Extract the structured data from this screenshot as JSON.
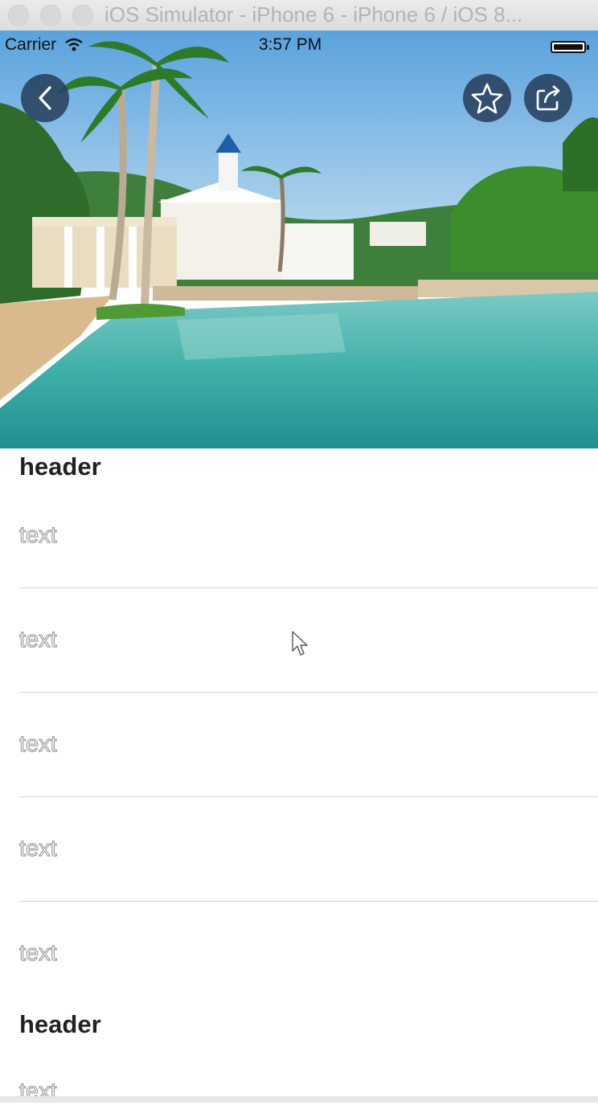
{
  "window": {
    "title": "iOS Simulator - iPhone 6 - iPhone 6 / iOS 8..."
  },
  "status_bar": {
    "carrier": "Carrier",
    "time": "3:57 PM",
    "wifi_icon": "wifi-icon",
    "battery_icon": "battery-icon"
  },
  "nav": {
    "back_icon": "chevron-left-icon",
    "favorite_icon": "star-icon",
    "share_icon": "share-icon"
  },
  "sections": [
    {
      "header": "header",
      "rows": [
        "text",
        "text",
        "text",
        "text",
        "text"
      ]
    },
    {
      "header": "header",
      "rows": [
        "text"
      ]
    }
  ],
  "colors": {
    "nav_button_bg": "#283e5c",
    "separator": "#d4d4d4",
    "header_text": "#222222"
  }
}
